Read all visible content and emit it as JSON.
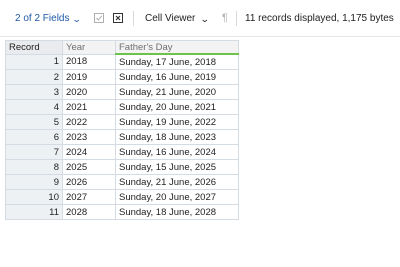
{
  "toolbar": {
    "fields_label": "2 of 2 Fields",
    "viewer_label": "Cell Viewer",
    "status_text": "11 records displayed, 1,175 bytes",
    "icons": [
      "chevron-down-icon",
      "checkbox-icon",
      "clear-icon",
      "pilcrow-icon"
    ]
  },
  "table": {
    "headers": [
      "Record",
      "Year",
      "Father's Day"
    ],
    "rows": [
      {
        "record": "1",
        "year": "2018",
        "day": "Sunday, 17 June, 2018"
      },
      {
        "record": "2",
        "year": "2019",
        "day": "Sunday, 16 June, 2019"
      },
      {
        "record": "3",
        "year": "2020",
        "day": "Sunday, 21 June, 2020"
      },
      {
        "record": "4",
        "year": "2021",
        "day": "Sunday, 20 June, 2021"
      },
      {
        "record": "5",
        "year": "2022",
        "day": "Sunday, 19 June, 2022"
      },
      {
        "record": "6",
        "year": "2023",
        "day": "Sunday, 18 June, 2023"
      },
      {
        "record": "7",
        "year": "2024",
        "day": "Sunday, 16 June, 2024"
      },
      {
        "record": "8",
        "year": "2025",
        "day": "Sunday, 15 June, 2025"
      },
      {
        "record": "9",
        "year": "2026",
        "day": "Sunday, 21 June, 2026"
      },
      {
        "record": "10",
        "year": "2027",
        "day": "Sunday, 20 June, 2027"
      },
      {
        "record": "11",
        "year": "2028",
        "day": "Sunday, 18 June, 2028"
      }
    ]
  },
  "colors": {
    "accent": "#1f5aa8",
    "header_underline": "#6cc24a",
    "grid_border": "#d4dbe3"
  }
}
